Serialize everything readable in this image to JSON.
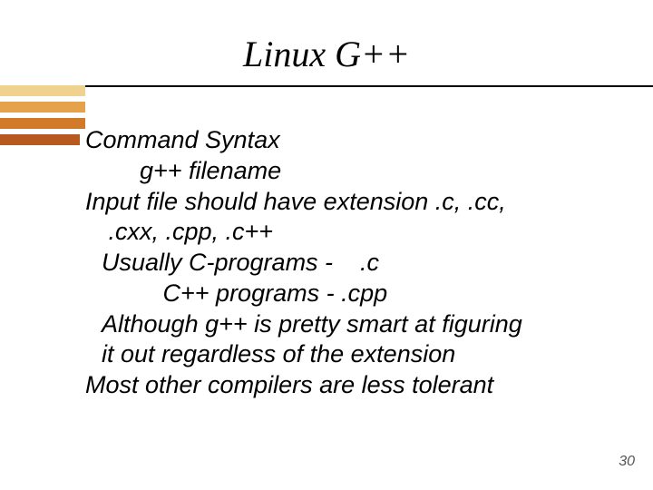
{
  "title": "Linux G++",
  "body": {
    "line1": "Command Syntax",
    "line2": "g++ filename",
    "line3": "Input file should have extension .c, .cc,",
    "line4": " .cxx, .cpp, .c++",
    "line5": "Usually C-programs -    .c",
    "line6": "         C++ programs - .cpp",
    "line7": "Although g++ is pretty smart at figuring",
    "line8": "it out regardless of the extension",
    "line9": "Most other compilers are less tolerant"
  },
  "page_number": "30"
}
